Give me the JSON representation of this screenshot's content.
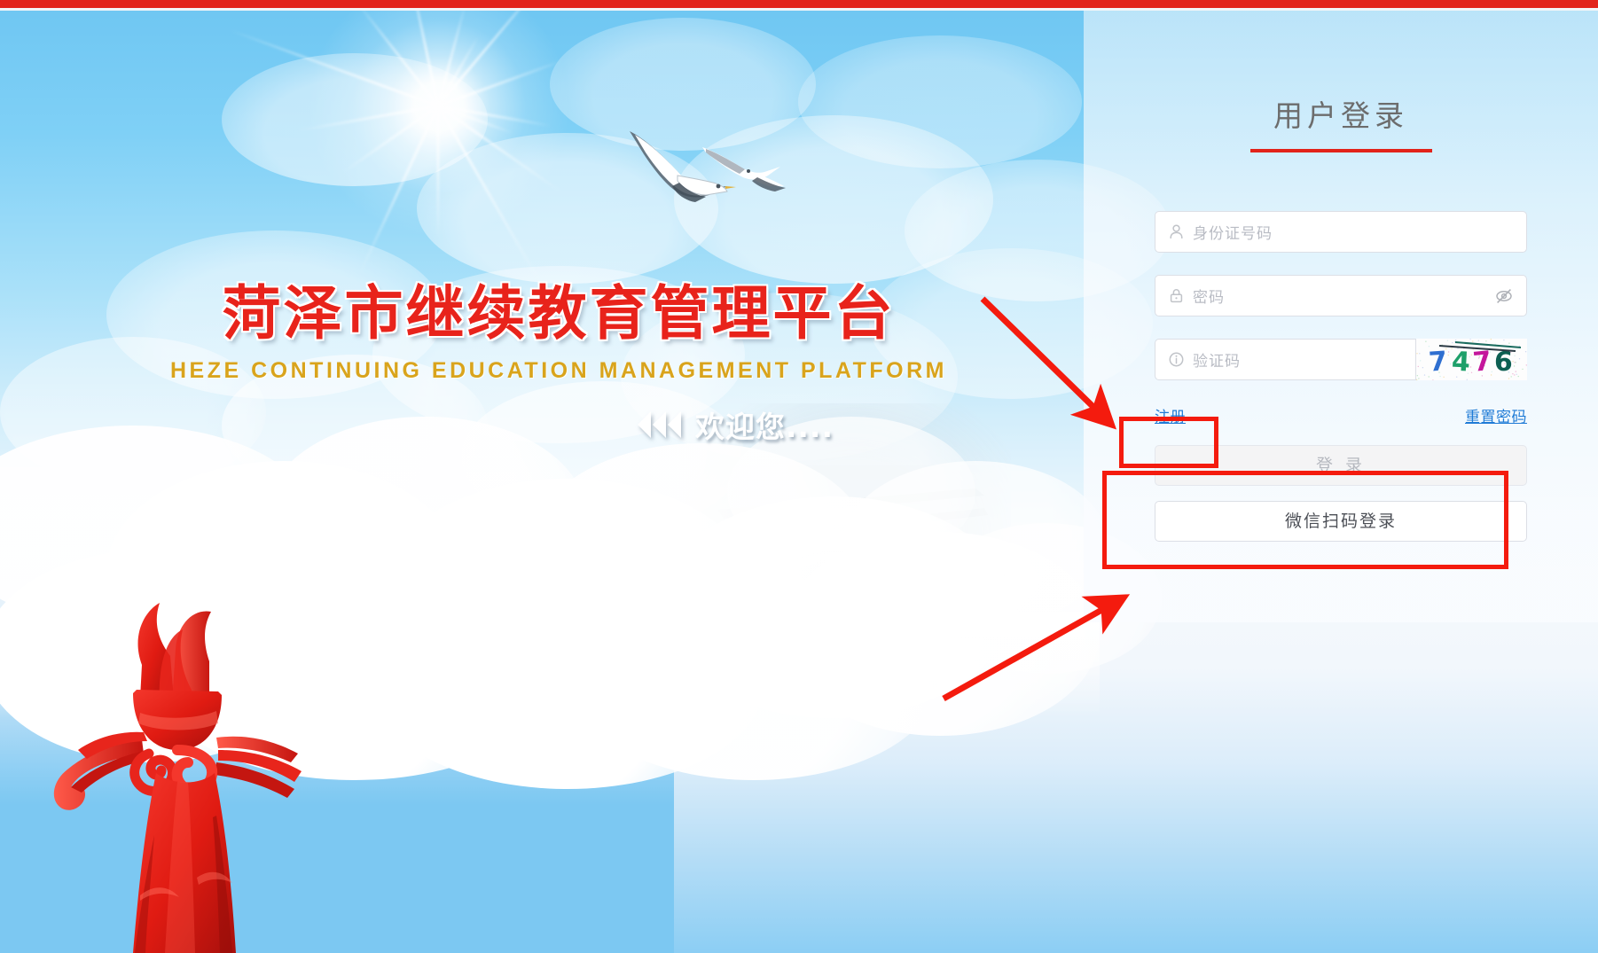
{
  "page": {
    "banner_title": "菏泽市继续教育管理平台",
    "banner_subtitle": "HEZE CONTINUING EDUCATION MANAGEMENT PLATFORM",
    "welcome_text": "欢迎您....",
    "chevron_icon": "triple-chevron-left-icon"
  },
  "login": {
    "title": "用户登录",
    "fields": [
      {
        "name": "id-number",
        "icon": "user-icon",
        "placeholder": "身份证号码",
        "value": ""
      },
      {
        "name": "password",
        "icon": "lock-icon",
        "placeholder": "密码",
        "value": "",
        "toggle_icon": "eye-slash-icon"
      },
      {
        "name": "captcha",
        "icon": "info-circle-icon",
        "placeholder": "验证码",
        "value": ""
      }
    ],
    "captcha": {
      "text": "7476",
      "digits": [
        {
          "char": "7",
          "color": "#2f6fd0"
        },
        {
          "char": "4",
          "color": "#1ea06a"
        },
        {
          "char": "7",
          "color": "#c4179b"
        },
        {
          "char": "6",
          "color": "#0d5f52"
        }
      ]
    },
    "links": {
      "register": "注册",
      "reset_password": "重置密码"
    },
    "buttons": {
      "login": "登 录",
      "wechat_login": "微信扫码登录"
    }
  },
  "colors": {
    "brand_red": "#e8231b",
    "subtitle_gold": "#d9a41c",
    "link_blue": "#1f7bd6",
    "annotation_red": "#f41b0e",
    "sky_top": "#6ec6f2",
    "panel_bg": "rgba(250,252,255,0.8)"
  }
}
